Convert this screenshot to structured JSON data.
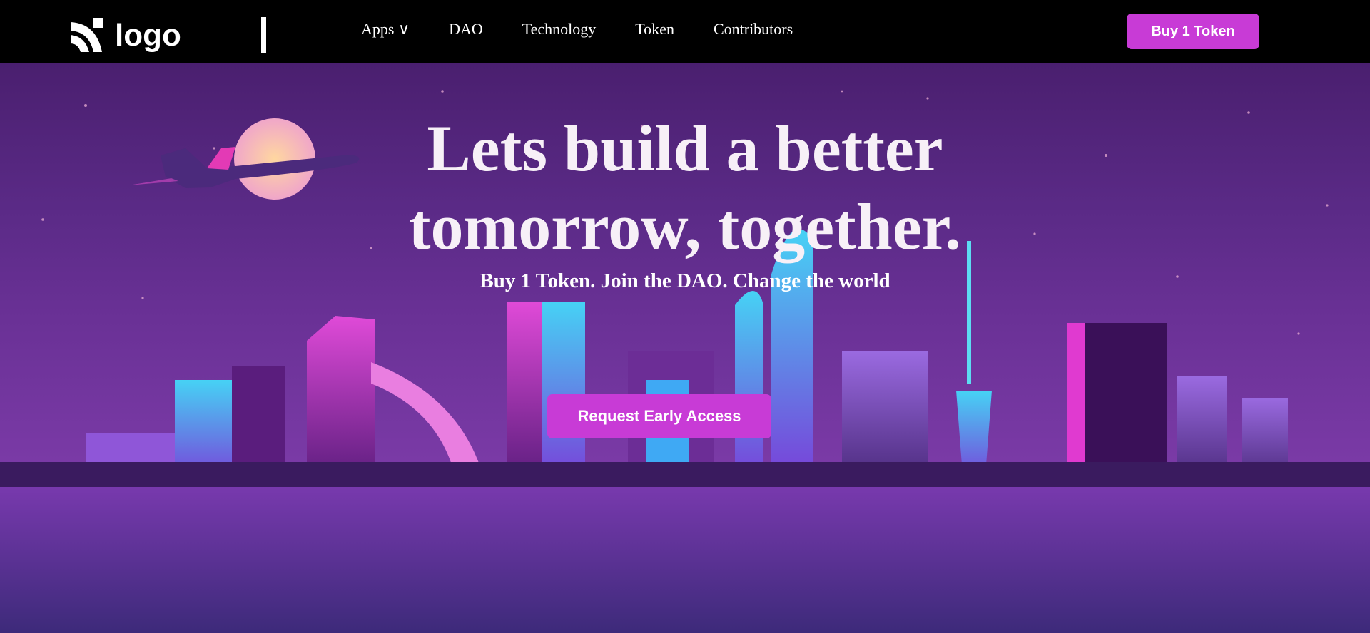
{
  "header": {
    "logo_text": "logo",
    "nav": [
      {
        "label": "Apps ∨"
      },
      {
        "label": "DAO"
      },
      {
        "label": "Technology"
      },
      {
        "label": "Token"
      },
      {
        "label": "Contributors"
      }
    ],
    "buy_button": "Buy 1 Token"
  },
  "hero": {
    "headline_line1": "Lets build a better",
    "headline_line2": "tomorrow, together.",
    "subheadline": "Buy 1 Token. Join the DAO. Change the world",
    "cta_button": "Request Early Access"
  },
  "colors": {
    "accent": "#c83bd6",
    "nav_bg": "#000000",
    "text": "#ffffff"
  },
  "icons": [
    "rss-logo-icon"
  ]
}
